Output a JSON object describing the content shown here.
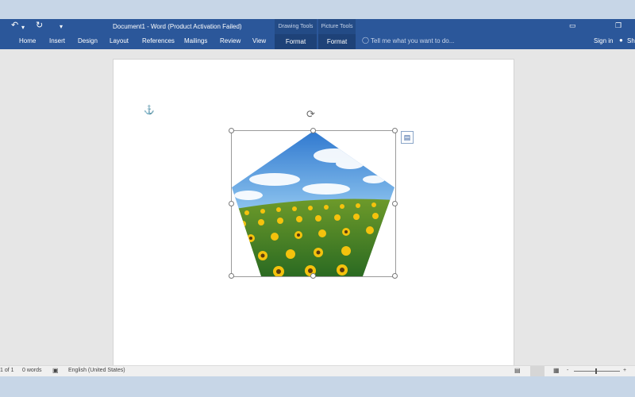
{
  "window": {
    "title": "Document1 - Word (Product Activation Failed)",
    "qat": {
      "undo_icon": "↶",
      "undo_arrow": "▾",
      "redo_icon": "↻",
      "customize_icon": "▾"
    },
    "controls": {
      "options_icon": "▭",
      "restore_icon": "❐",
      "close_icon": "✕"
    }
  },
  "ribbon": {
    "tabs": [
      "Home",
      "Insert",
      "Design",
      "Layout",
      "References",
      "Mailings",
      "Review",
      "View"
    ],
    "contextual": [
      {
        "group": "Drawing Tools",
        "tab": "Format"
      },
      {
        "group": "Picture Tools",
        "tab": "Format"
      }
    ],
    "tell_me": "Tell me what you want to do...",
    "sign_in": "Sign in",
    "share": "Sh"
  },
  "document": {
    "shape": "pentagon",
    "image_description": "sunflower field under blue sky",
    "colors": {
      "sky": "#3a86d6",
      "field": "#2e7a2a",
      "flower": "#f5c400"
    }
  },
  "statusbar": {
    "page": "1 of 1",
    "words": "0 words",
    "language": "English (United States)",
    "zoom_minus": "-",
    "zoom_plus": "+"
  },
  "colors": {
    "accent": "#2b579a",
    "canvas": "#e6e6e6"
  }
}
